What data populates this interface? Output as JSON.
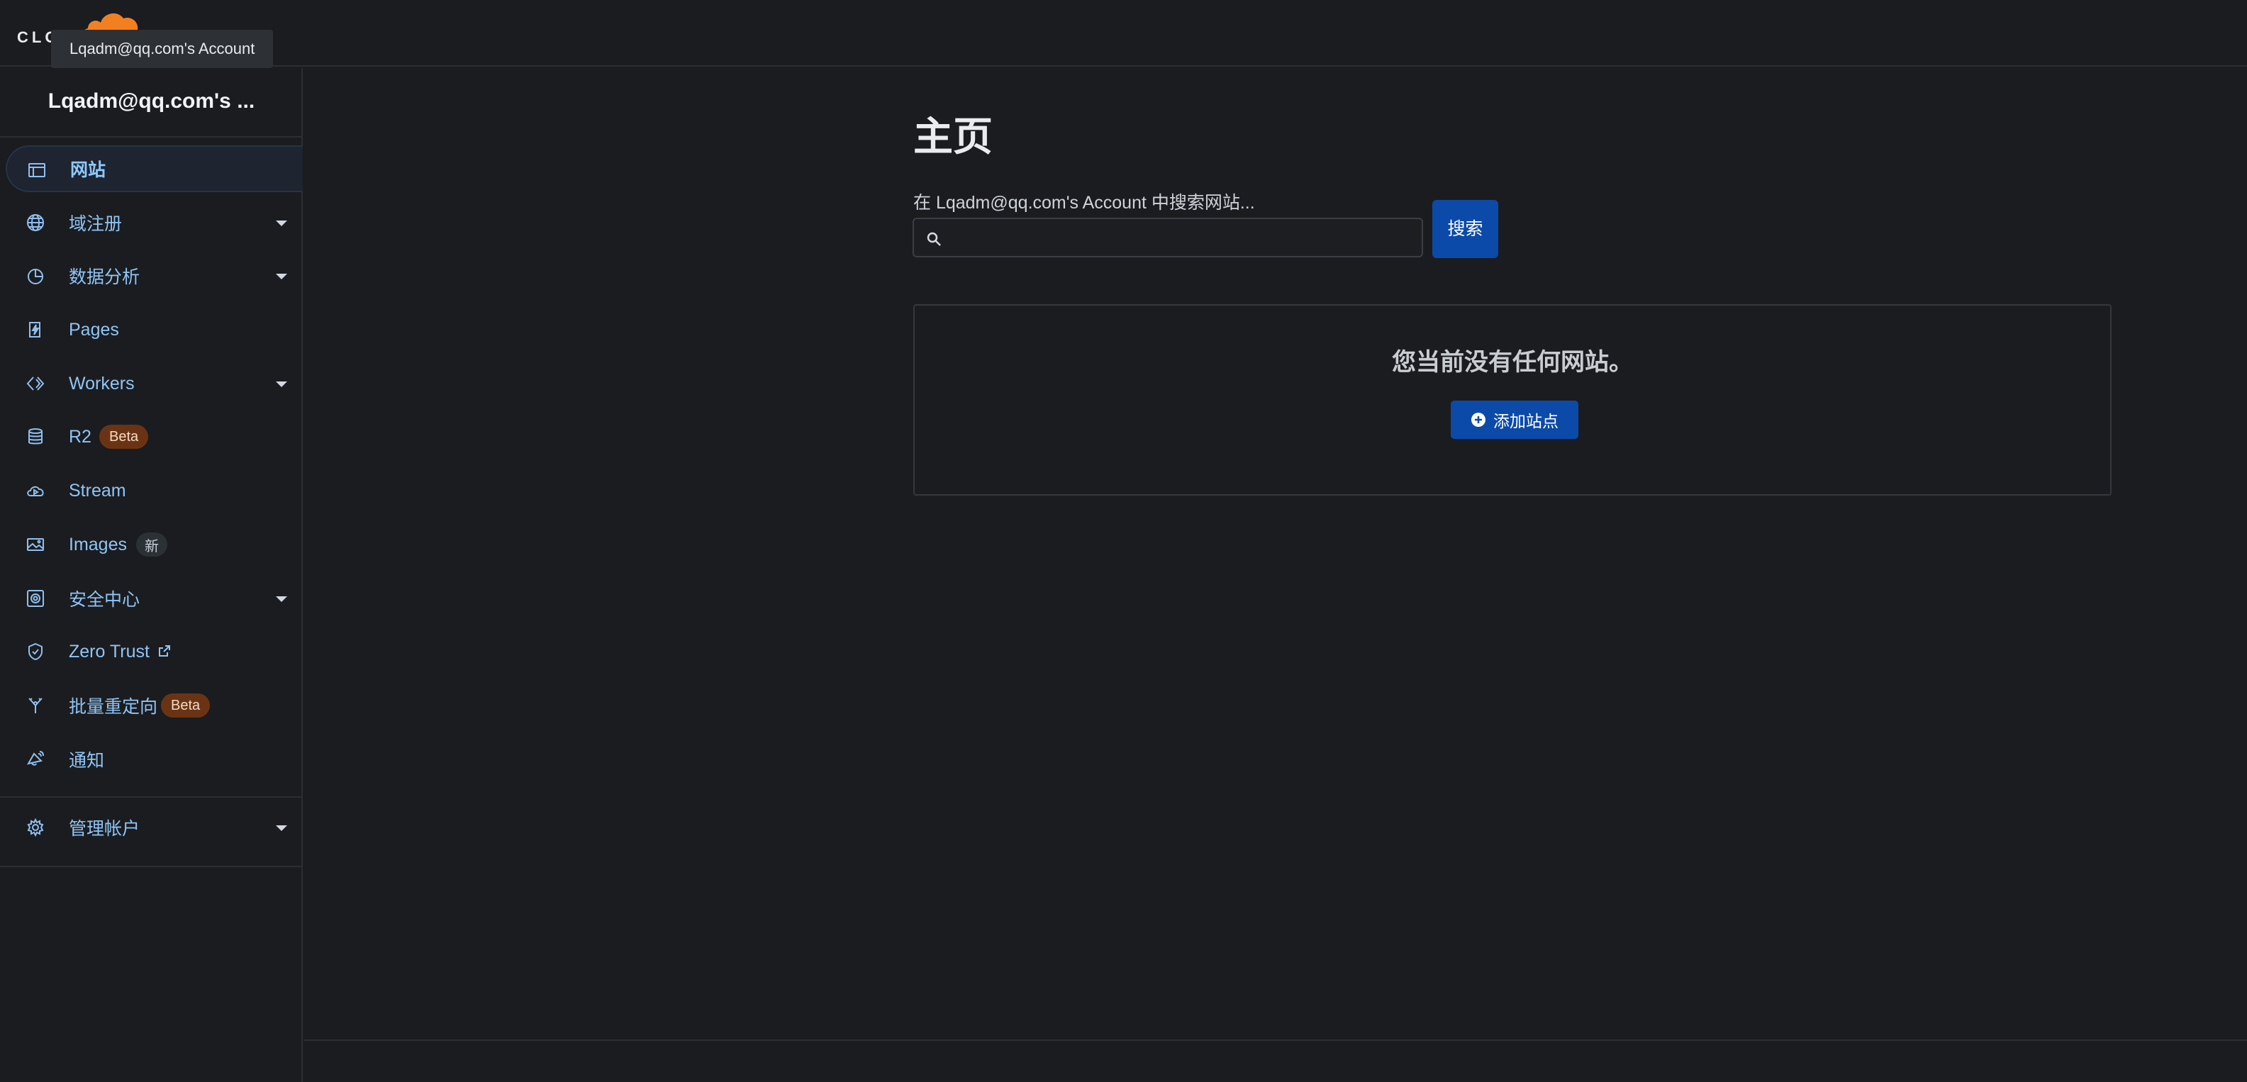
{
  "header": {
    "logo_text": "CLO",
    "tooltip": "Lqadm@qq.com's Account",
    "brand_color": "#f38020"
  },
  "sidebar": {
    "account_name": "Lqadm@qq.com's ...",
    "items": [
      {
        "label": "网站",
        "icon": "browser-window-icon",
        "active": true
      },
      {
        "label": "域注册",
        "icon": "globe-icon",
        "dropdown": true
      },
      {
        "label": "数据分析",
        "icon": "pie-chart-icon",
        "dropdown": true
      },
      {
        "label": "Pages",
        "icon": "lightning-page-icon"
      },
      {
        "label": "Workers",
        "icon": "workers-diamond-icon",
        "dropdown": true
      },
      {
        "label": "R2",
        "icon": "database-icon",
        "badge": "Beta"
      },
      {
        "label": "Stream",
        "icon": "cloud-play-icon"
      },
      {
        "label": "Images",
        "icon": "image-icon",
        "badge": "新"
      },
      {
        "label": "安全中心",
        "icon": "security-center-icon",
        "dropdown": true
      },
      {
        "label": "Zero Trust",
        "icon": "shield-check-icon",
        "external": true
      },
      {
        "label": "批量重定向",
        "icon": "redirect-fork-icon",
        "badge": "Beta"
      },
      {
        "label": "通知",
        "icon": "notification-icon"
      },
      {
        "label": "管理帐户",
        "icon": "gear-icon",
        "dropdown": true
      }
    ]
  },
  "main": {
    "title": "主页",
    "search": {
      "label": "在 Lqadm@qq.com's Account 中搜索网站...",
      "value": "",
      "button_label": "搜索"
    },
    "empty_state": {
      "message": "您当前没有任何网站。",
      "add_button_label": "添加站点"
    }
  },
  "colors": {
    "background": "#1b1c1f",
    "accent_blue": "#0b4aa8",
    "link_blue": "#8fc5f7",
    "beta_badge": "#6a3414"
  }
}
